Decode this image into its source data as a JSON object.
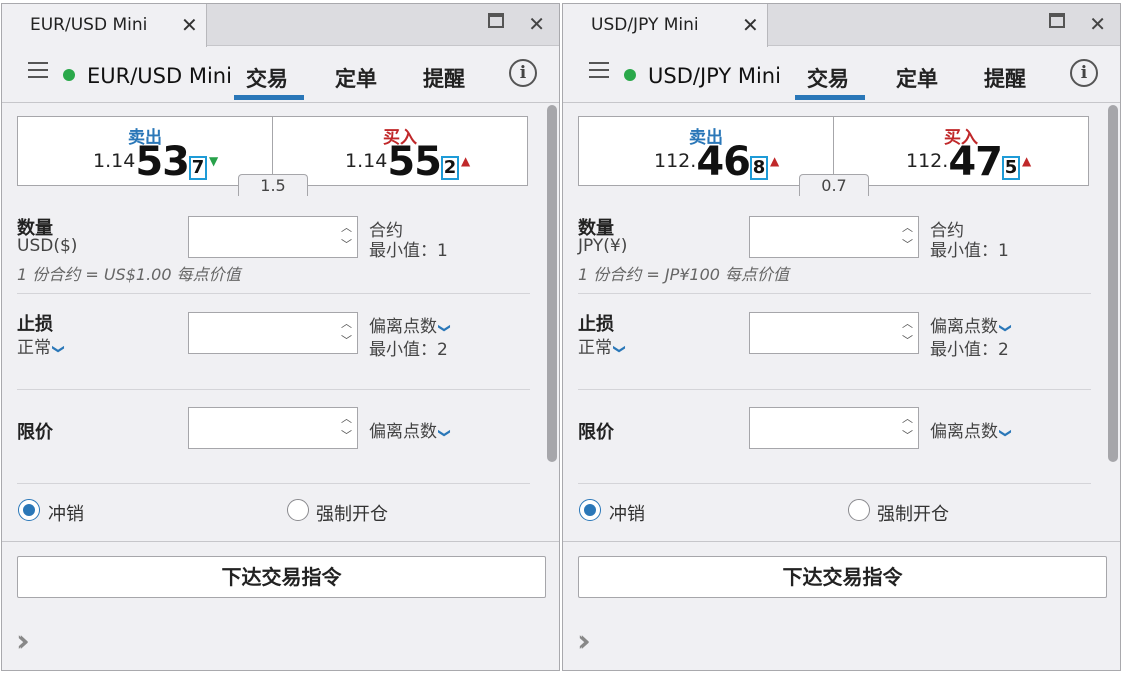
{
  "panels": [
    {
      "tab_title": "EUR/USD Mini",
      "instrument": "EUR/USD Mini",
      "nav_tabs": [
        "交易",
        "定单",
        "提醒"
      ],
      "sell": {
        "label": "卖出",
        "prefix": "1.14",
        "big": "53",
        "pip": "7",
        "arrow": "▼"
      },
      "buy": {
        "label": "买入",
        "prefix": "1.14",
        "big": "55",
        "pip": "2",
        "arrow": "▲"
      },
      "spread": "1.5",
      "quantity": {
        "label": "数量",
        "currency": "USD($)",
        "side_line1": "合约",
        "side_line2": "最小值：1",
        "hint": "1 份合约 = US$1.00 每点价值",
        "value": ""
      },
      "stop": {
        "label": "止损",
        "mode": "正常",
        "side_line1": "偏离点数",
        "side_line2": "最小值：2",
        "value": ""
      },
      "limit": {
        "label": "限价",
        "side_line1": "偏离点数",
        "value": ""
      },
      "radio": {
        "option1": "冲销",
        "option2": "强制开仓",
        "selected": "冲销"
      },
      "submit_label": "下达交易指令"
    },
    {
      "tab_title": "USD/JPY Mini",
      "instrument": "USD/JPY Mini",
      "nav_tabs": [
        "交易",
        "定单",
        "提醒"
      ],
      "sell": {
        "label": "卖出",
        "prefix": "112.",
        "big": "46",
        "pip": "8",
        "arrow": "▲"
      },
      "buy": {
        "label": "买入",
        "prefix": "112.",
        "big": "47",
        "pip": "5",
        "arrow": "▲"
      },
      "spread": "0.7",
      "quantity": {
        "label": "数量",
        "currency": "JPY(¥)",
        "side_line1": "合约",
        "side_line2": "最小值：1",
        "hint": "1 份合约 = JP¥100 每点价值",
        "value": ""
      },
      "stop": {
        "label": "止损",
        "mode": "正常",
        "side_line1": "偏离点数",
        "side_line2": "最小值：2",
        "value": ""
      },
      "limit": {
        "label": "限价",
        "side_line1": "偏离点数",
        "value": ""
      },
      "radio": {
        "option1": "冲销",
        "option2": "强制开仓",
        "selected": "冲销"
      },
      "submit_label": "下达交易指令"
    }
  ],
  "icons": {
    "tab_close": "close-icon",
    "window_maximize": "maximize-icon",
    "window_close": "close-icon",
    "menu": "hamburger-menu-icon",
    "status": "live-status-dot",
    "info": "info-icon",
    "dropdown": "chevron-down-icon",
    "expand": "double-chevron-right-icon"
  },
  "colors": {
    "sell_label": "#2a77b8",
    "buy_label": "#c0282a",
    "arrow_down": "#27a14a",
    "arrow_up": "#c0282a",
    "active_tab_underline": "#2a77b8",
    "live_dot": "#2aa84a",
    "pip_box_border": "#1e9bd7"
  }
}
